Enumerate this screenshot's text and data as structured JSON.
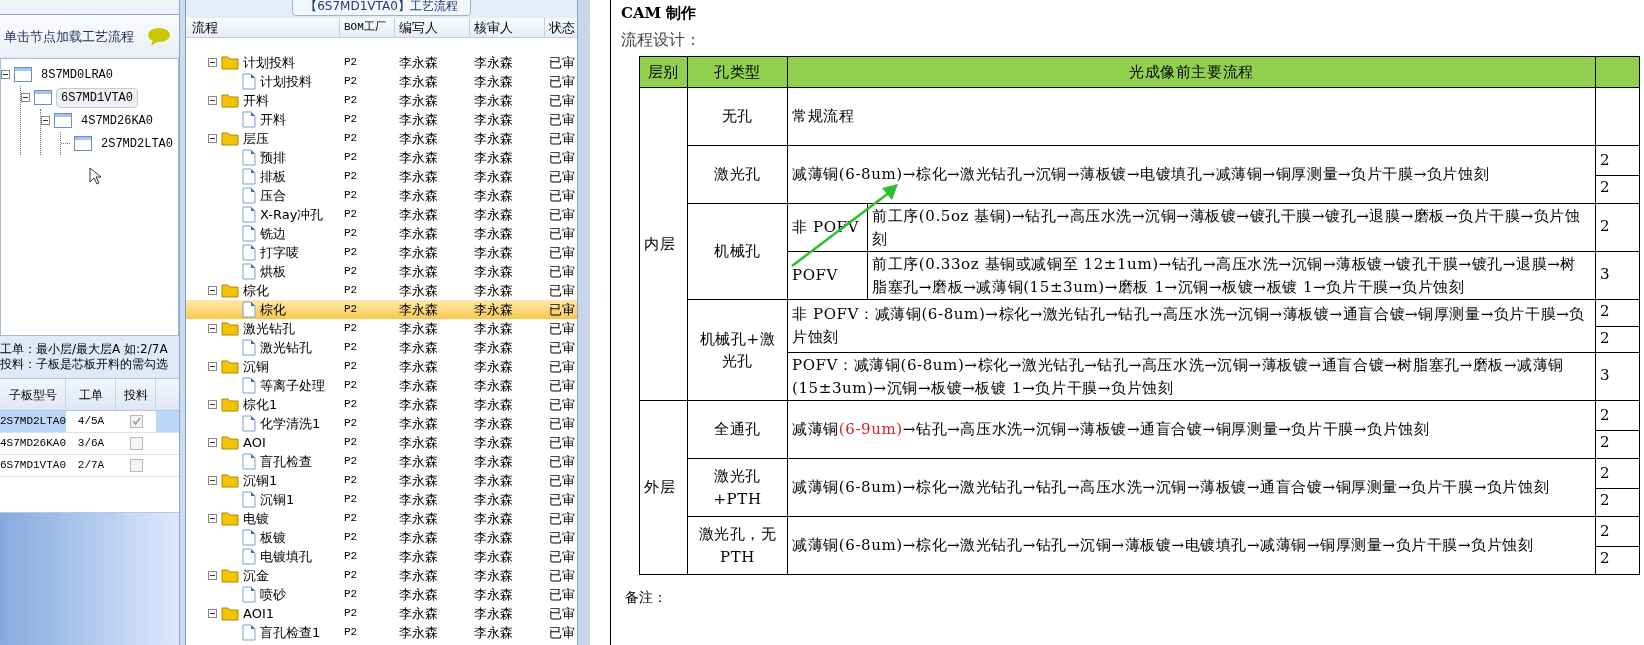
{
  "left_panel": {
    "header": "单击节点加载工艺流程",
    "tree": [
      {
        "label": "8S7MD0LRA0",
        "selected": false,
        "children": [
          {
            "label": "6S7MD1VTA0",
            "selected": true,
            "children": [
              {
                "label": "4S7MD26KA0",
                "selected": false,
                "children": [
                  {
                    "label": "2S7MD2LTA0",
                    "selected": false
                  }
                ]
              }
            ]
          }
        ]
      }
    ],
    "notes": [
      "工单：最小层/最大层A 如:2/7A",
      "投料：子板是芯板开料的需勾选"
    ],
    "table": {
      "columns": [
        "子板型号",
        "工单",
        "投料"
      ],
      "rows": [
        {
          "model": "2S7MD2LTA0",
          "order": "4/5A",
          "checked": true,
          "selected": true
        },
        {
          "model": "4S7MD26KA0",
          "order": "3/6A",
          "checked": false,
          "selected": false
        },
        {
          "model": "6S7MD1VTA0",
          "order": "2/7A",
          "checked": false,
          "selected": false
        }
      ]
    }
  },
  "process_panel": {
    "title": "【6S7MD1VTA0】工艺流程",
    "columns": [
      "流程",
      "BOM工厂",
      "编写人",
      "核审人",
      "状态"
    ],
    "tree": [
      {
        "label": "计划投料",
        "bom": "P2",
        "writer": "李永森",
        "reviewer": "李永森",
        "status": "已审",
        "selected": false,
        "children": [
          {
            "label": "计划投料",
            "bom": "P2",
            "writer": "李永森",
            "reviewer": "李永森",
            "status": "已审",
            "selected": false
          }
        ]
      },
      {
        "label": "开料",
        "bom": "P2",
        "writer": "李永森",
        "reviewer": "李永森",
        "status": "已审",
        "selected": false,
        "children": [
          {
            "label": "开料",
            "bom": "P2",
            "writer": "李永森",
            "reviewer": "李永森",
            "status": "已审",
            "selected": false
          }
        ]
      },
      {
        "label": "层压",
        "bom": "P2",
        "writer": "李永森",
        "reviewer": "李永森",
        "status": "已审",
        "selected": false,
        "children": [
          {
            "label": "预排",
            "bom": "P2",
            "writer": "李永森",
            "reviewer": "李永森",
            "status": "已审",
            "selected": false
          },
          {
            "label": "排板",
            "bom": "P2",
            "writer": "李永森",
            "reviewer": "李永森",
            "status": "已审",
            "selected": false
          },
          {
            "label": "压合",
            "bom": "P2",
            "writer": "李永森",
            "reviewer": "李永森",
            "status": "已审",
            "selected": false
          },
          {
            "label": "X-Ray冲孔",
            "bom": "P2",
            "writer": "李永森",
            "reviewer": "李永森",
            "status": "已审",
            "selected": false
          },
          {
            "label": "铣边",
            "bom": "P2",
            "writer": "李永森",
            "reviewer": "李永森",
            "status": "已审",
            "selected": false
          },
          {
            "label": "打字唛",
            "bom": "P2",
            "writer": "李永森",
            "reviewer": "李永森",
            "status": "已审",
            "selected": false
          },
          {
            "label": "烘板",
            "bom": "P2",
            "writer": "李永森",
            "reviewer": "李永森",
            "status": "已审",
            "selected": false
          }
        ]
      },
      {
        "label": "棕化",
        "bom": "P2",
        "writer": "李永森",
        "reviewer": "李永森",
        "status": "已审",
        "selected": false,
        "children": [
          {
            "label": "棕化",
            "bom": "P2",
            "writer": "李永森",
            "reviewer": "李永森",
            "status": "已审",
            "selected": true
          }
        ]
      },
      {
        "label": "激光钻孔",
        "bom": "P2",
        "writer": "李永森",
        "reviewer": "李永森",
        "status": "已审",
        "selected": false,
        "children": [
          {
            "label": "激光钻孔",
            "bom": "P2",
            "writer": "李永森",
            "reviewer": "李永森",
            "status": "已审",
            "selected": false
          }
        ]
      },
      {
        "label": "沉铜",
        "bom": "P2",
        "writer": "李永森",
        "reviewer": "李永森",
        "status": "已审",
        "selected": false,
        "children": [
          {
            "label": "等离子处理",
            "bom": "P2",
            "writer": "李永森",
            "reviewer": "李永森",
            "status": "已审",
            "selected": false
          }
        ]
      },
      {
        "label": "棕化1",
        "bom": "P2",
        "writer": "李永森",
        "reviewer": "李永森",
        "status": "已审",
        "selected": false,
        "children": [
          {
            "label": "化学清洗1",
            "bom": "P2",
            "writer": "李永森",
            "reviewer": "李永森",
            "status": "已审",
            "selected": false
          }
        ]
      },
      {
        "label": "AOI",
        "bom": "P2",
        "writer": "李永森",
        "reviewer": "李永森",
        "status": "已审",
        "selected": false,
        "children": [
          {
            "label": "盲孔检查",
            "bom": "P2",
            "writer": "李永森",
            "reviewer": "李永森",
            "status": "已审",
            "selected": false
          }
        ]
      },
      {
        "label": "沉铜1",
        "bom": "P2",
        "writer": "李永森",
        "reviewer": "李永森",
        "status": "已审",
        "selected": false,
        "children": [
          {
            "label": "沉铜1",
            "bom": "P2",
            "writer": "李永森",
            "reviewer": "李永森",
            "status": "已审",
            "selected": false
          }
        ]
      },
      {
        "label": "电镀",
        "bom": "P2",
        "writer": "李永森",
        "reviewer": "李永森",
        "status": "已审",
        "selected": false,
        "children": [
          {
            "label": "板镀",
            "bom": "P2",
            "writer": "李永森",
            "reviewer": "李永森",
            "status": "已审",
            "selected": false
          },
          {
            "label": "电镀填孔",
            "bom": "P2",
            "writer": "李永森",
            "reviewer": "李永森",
            "status": "已审",
            "selected": false
          }
        ]
      },
      {
        "label": "沉金",
        "bom": "P2",
        "writer": "李永森",
        "reviewer": "李永森",
        "status": "已审",
        "selected": false,
        "children": [
          {
            "label": "喷砂",
            "bom": "P2",
            "writer": "李永森",
            "reviewer": "李永森",
            "status": "已审",
            "selected": false
          }
        ]
      },
      {
        "label": "AOI1",
        "bom": "P2",
        "writer": "李永森",
        "reviewer": "李永森",
        "status": "已审",
        "selected": false,
        "children": [
          {
            "label": "盲孔检查1",
            "bom": "P2",
            "writer": "李永森",
            "reviewer": "李永森",
            "status": "已审",
            "selected": false
          }
        ]
      }
    ]
  },
  "document": {
    "heading": "CAM 制作",
    "subheading": "流程设计：",
    "table": {
      "columns": [
        "层别",
        "孔类型",
        "光成像前主要流程"
      ],
      "layers": [
        {
          "label": "内层",
          "holes": [
            {
              "type": "无孔",
              "variants": [
                {
                  "flow": [
                    {
                      "text": "常规流程",
                      "marked": false
                    }
                  ]
                }
              ]
            },
            {
              "type": "激光孔",
              "variants": [
                {
                  "flow": [
                    {
                      "text": "减薄铜(6-8um)→棕化→激光钻孔→沉铜→薄板镀→电镀填孔→减薄铜→铜厚测量→负片干膜→负片蚀刻",
                      "marked": false
                    }
                  ],
                  "column_5": [
                    "2",
                    "2"
                  ]
                }
              ]
            },
            {
              "type": "机械孔",
              "variants": [
                {
                  "name": "非 POFV",
                  "flow": [
                    {
                      "text": "前工序(0.5oz 基铜)→钻孔→高压水洗→沉铜→薄板镀→镀孔干膜→镀孔→退膜→磨板→负片干膜→负片蚀刻",
                      "marked": false
                    }
                  ],
                  "column_5": [
                    "2"
                  ]
                },
                {
                  "name": "POFV",
                  "flow": [
                    {
                      "text": "前工序(0.33oz 基铜或减铜至 12±1um)→钻孔→高压水洗→沉铜→薄板镀→镀孔干膜→镀孔→退膜→树脂塞孔→磨板→减薄铜(15±3um)→磨板 1→沉铜→板镀→板镀 1→负片干膜→负片蚀刻",
                      "marked": false
                    }
                  ],
                  "column_5": [
                    "3"
                  ]
                }
              ]
            },
            {
              "type": "机械孔+激光孔",
              "variants": [
                {
                  "flow": [
                    {
                      "text": "非 POFV：减薄铜(6-8um)→棕化→激光钻孔→钻孔→高压水洗→沉铜→薄板镀→通盲合镀→铜厚测量→负片干膜→负片蚀刻",
                      "marked": false
                    }
                  ],
                  "column_5": [
                    "2",
                    "2"
                  ]
                },
                {
                  "flow": [
                    {
                      "text": "POFV：减薄铜(6-8um)→棕化→激光钻孔→钻孔→高压水洗→沉铜→薄板镀→通盲合镀→树脂塞孔→磨板→减薄铜(15±3um)→沉铜→板镀→板镀 1→负片干膜→负片蚀刻",
                      "marked": false
                    }
                  ],
                  "column_5": [
                    "3"
                  ]
                }
              ]
            }
          ]
        },
        {
          "label": "外层",
          "holes": [
            {
              "type": "全通孔",
              "variants": [
                {
                  "flow": [
                    {
                      "text": "减薄铜",
                      "marked": false
                    },
                    {
                      "text": "(6-9um)",
                      "marked": true
                    },
                    {
                      "text": "→钻孔→高压水洗→沉铜→薄板镀→通盲合镀→铜厚测量→负片干膜→负片蚀刻",
                      "marked": false
                    }
                  ],
                  "column_5": [
                    "2",
                    "2"
                  ]
                }
              ]
            },
            {
              "type": "激光孔+PTH",
              "variants": [
                {
                  "flow": [
                    {
                      "text": "减薄铜(6-8um)→棕化→激光钻孔→钻孔→高压水洗→沉铜→薄板镀→通盲合镀→铜厚测量→负片干膜→负片蚀刻",
                      "marked": false
                    }
                  ],
                  "column_5": [
                    "2",
                    "2"
                  ]
                }
              ]
            },
            {
              "type": "激光孔，无 PTH",
              "variants": [
                {
                  "flow": [
                    {
                      "text": "减薄铜(6-8um)→棕化→激光钻孔→钻孔→沉铜→薄板镀→电镀填孔→减薄铜→铜厚测量→负片干膜→负片蚀刻",
                      "marked": false
                    }
                  ],
                  "column_5": [
                    "2",
                    "2"
                  ]
                }
              ]
            }
          ]
        }
      ]
    },
    "remark": "备注："
  }
}
